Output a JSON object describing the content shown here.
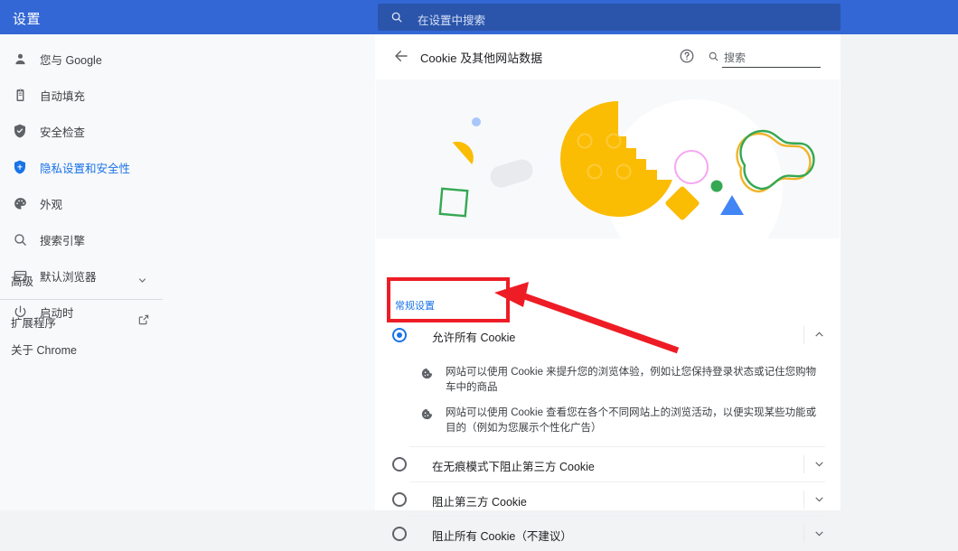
{
  "app": {
    "brand": "设置",
    "top_search_placeholder": "在设置中搜索",
    "search_icon": "search-icon"
  },
  "sidebar": {
    "items": [
      {
        "label": "您与 Google",
        "icon": "person-icon",
        "active": false
      },
      {
        "label": "自动填充",
        "icon": "clipboard-icon",
        "active": false
      },
      {
        "label": "安全检查",
        "icon": "shield-check-icon",
        "active": false
      },
      {
        "label": "隐私设置和安全性",
        "icon": "shield-icon",
        "active": true
      },
      {
        "label": "外观",
        "icon": "palette-icon",
        "active": false
      },
      {
        "label": "搜索引擎",
        "icon": "search-icon",
        "active": false
      },
      {
        "label": "默认浏览器",
        "icon": "browser-window-icon",
        "active": false
      },
      {
        "label": "启动时",
        "icon": "power-icon",
        "active": false
      }
    ],
    "advanced": {
      "label": "高级",
      "icon": "chevron-down-icon"
    },
    "footer": [
      {
        "label": "扩展程序",
        "icon": "external-link-icon"
      },
      {
        "label": "关于 Chrome",
        "icon": ""
      }
    ]
  },
  "content": {
    "back_icon": "arrow-left-icon",
    "title": "Cookie 及其他网站数据",
    "help_icon": "help-circle-icon",
    "inline_search": {
      "icon": "search-icon",
      "placeholder": "搜索",
      "value": ""
    },
    "illustration": {
      "name": "cookie-illustration",
      "colors": {
        "cookie_yellow": "#fbbc04",
        "green": "#34a853",
        "blue": "#4285f4",
        "pink": "#f7a7f2",
        "gray": "#e8eaed",
        "light_blue": "#a8c7fa",
        "backdrop": "#f8f9fa"
      }
    },
    "section_title": "常规设置",
    "options": [
      {
        "label": "允许所有 Cookie",
        "selected": true,
        "expanded": true,
        "chevron": "chevron-up-icon",
        "descriptions": [
          "网站可以使用 Cookie 来提升您的浏览体验，例如让您保持登录状态或记住您购物车中的商品",
          "网站可以使用 Cookie 查看您在各个不同网站上的浏览活动，以便实现某些功能或目的（例如为您展示个性化广告）"
        ]
      },
      {
        "label": "在无痕模式下阻止第三方 Cookie",
        "selected": false,
        "expanded": false,
        "chevron": "chevron-down-icon",
        "descriptions": []
      },
      {
        "label": "阻止第三方 Cookie",
        "selected": false,
        "expanded": false,
        "chevron": "chevron-down-icon",
        "descriptions": []
      },
      {
        "label": "阻止所有 Cookie（不建议）",
        "selected": false,
        "expanded": false,
        "chevron": "chevron-down-icon",
        "descriptions": []
      }
    ]
  },
  "annotation": {
    "color": "#ee1c25",
    "highlight_target": "允许所有 Cookie",
    "shapes": [
      "rectangle-outline",
      "arrow-pointing-left"
    ]
  }
}
